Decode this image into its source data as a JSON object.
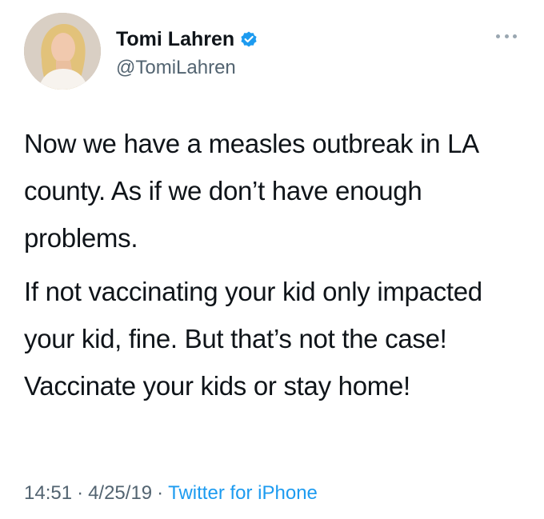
{
  "user": {
    "display_name": "Tomi Lahren",
    "handle": "@TomiLahren",
    "verified": true
  },
  "tweet": {
    "paragraphs": [
      "Now we have a measles outbreak in LA county. As if we don’t have enough problems.",
      "If not vaccinating your kid only impacted your kid, fine. But that’s not the case! Vaccinate your kids or stay home!"
    ],
    "time": "14:51",
    "date": "4/25/19",
    "separator": "·",
    "source": "Twitter for iPhone"
  },
  "icons": {
    "verified": "verified-badge-icon",
    "more": "more-options-icon"
  },
  "colors": {
    "accent": "#1d9bf0",
    "text": "#0f1419",
    "secondary": "#536471"
  }
}
